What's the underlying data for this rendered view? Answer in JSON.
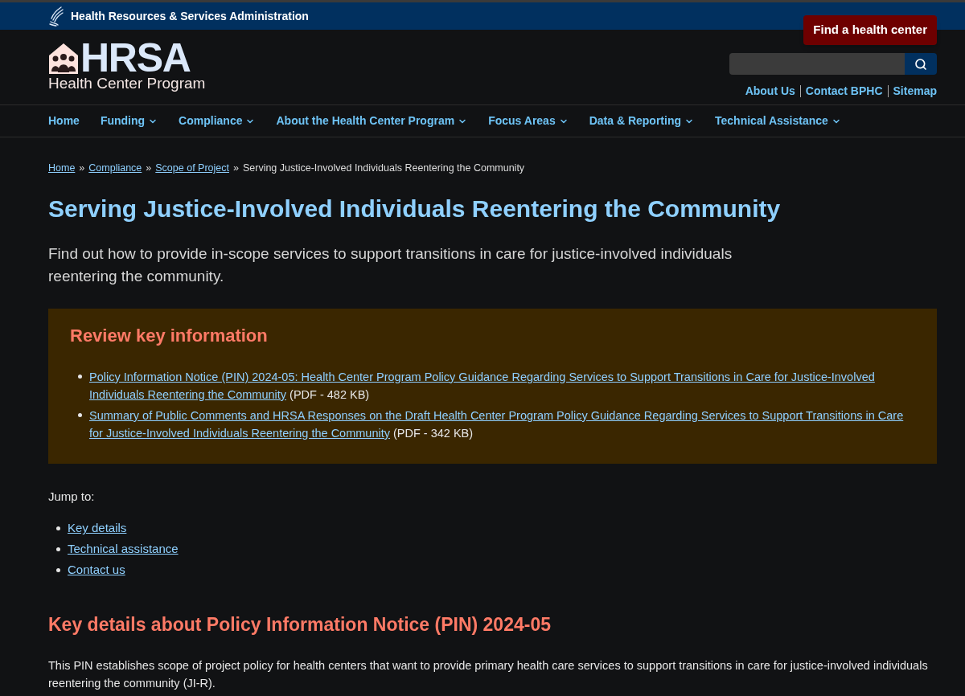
{
  "agency_bar": {
    "title": "Health Resources & Services Administration"
  },
  "header": {
    "logo_mark": "HRSA",
    "logo_subtitle": "Health Center Program",
    "cta_button": "Find a health center",
    "utility_links": [
      "About Us",
      "Contact BPHC",
      "Sitemap"
    ]
  },
  "nav": [
    {
      "label": "Home",
      "dropdown": false
    },
    {
      "label": "Funding",
      "dropdown": true
    },
    {
      "label": "Compliance",
      "dropdown": true
    },
    {
      "label": "About the Health Center Program",
      "dropdown": true
    },
    {
      "label": "Focus Areas",
      "dropdown": true
    },
    {
      "label": "Data & Reporting",
      "dropdown": true
    },
    {
      "label": "Technical Assistance",
      "dropdown": true
    }
  ],
  "breadcrumb": {
    "links": [
      "Home",
      "Compliance",
      "Scope of Project"
    ],
    "separator": "»",
    "current": "Serving Justice-Involved Individuals Reentering the Community"
  },
  "page_title": "Serving Justice-Involved Individuals Reentering the Community",
  "lead": "Find out how to provide in-scope services to support transitions in care for justice-involved individuals reentering the community.",
  "review_box": {
    "heading": "Review key information",
    "items": [
      {
        "link": "Policy Information Notice (PIN) 2024-05: Health Center Program Policy Guidance Regarding Services to Support Transitions in Care for Justice-Involved Individuals Reentering the Community",
        "note": "(PDF - 482 KB)"
      },
      {
        "link": "Summary of Public Comments and HRSA Responses on the Draft Health Center Program Policy Guidance Regarding Services to Support Transitions in Care for Justice-Involved Individuals Reentering the Community",
        "note": "(PDF - 342 KB)"
      }
    ]
  },
  "jump_to": {
    "label": "Jump to:",
    "links": [
      "Key details",
      "Technical assistance",
      "Contact us"
    ]
  },
  "section": {
    "heading": "Key details about Policy Information Notice (PIN) 2024-05",
    "body": "This PIN establishes scope of project policy for health centers that want to provide primary health care services to support transitions in care for justice-involved individuals reentering the community (JI-R)."
  }
}
